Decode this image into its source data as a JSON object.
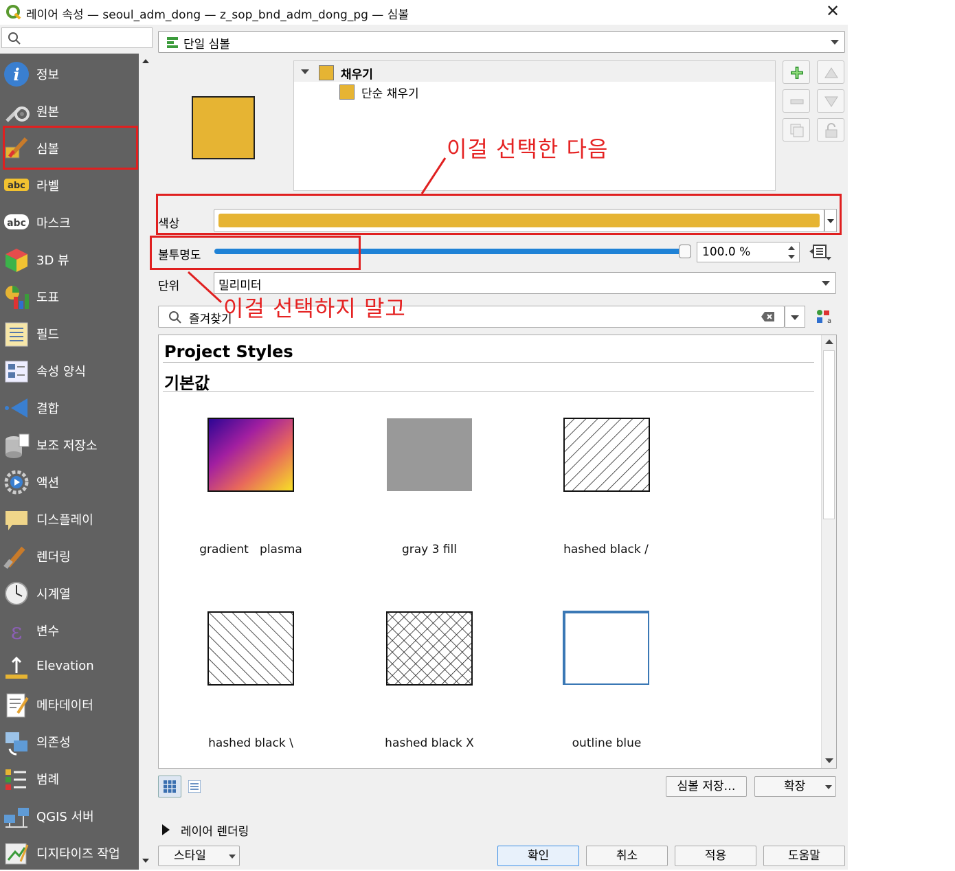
{
  "window": {
    "title": "레이어 속성 — seoul_adm_dong — z_sop_bnd_adm_dong_pg — 심볼",
    "close": "✕"
  },
  "sidebar": {
    "search_placeholder": "",
    "items": [
      {
        "label": "정보",
        "icon": "info-icon"
      },
      {
        "label": "원본",
        "icon": "source-icon"
      },
      {
        "label": "심볼",
        "icon": "symbology-icon",
        "selected": true
      },
      {
        "label": "라벨",
        "icon": "labels-icon"
      },
      {
        "label": "마스크",
        "icon": "mask-icon"
      },
      {
        "label": "3D 뷰",
        "icon": "3d-view-icon"
      },
      {
        "label": "도표",
        "icon": "diagram-icon"
      },
      {
        "label": "필드",
        "icon": "fields-icon"
      },
      {
        "label": "속성 양식",
        "icon": "attributes-form-icon"
      },
      {
        "label": "결합",
        "icon": "joins-icon"
      },
      {
        "label": "보조 저장소",
        "icon": "auxiliary-storage-icon"
      },
      {
        "label": "액션",
        "icon": "actions-icon"
      },
      {
        "label": "디스플레이",
        "icon": "display-icon"
      },
      {
        "label": "렌더링",
        "icon": "rendering-icon"
      },
      {
        "label": "시계열",
        "icon": "temporal-icon"
      },
      {
        "label": "변수",
        "icon": "variables-icon"
      },
      {
        "label": "Elevation",
        "icon": "elevation-icon"
      },
      {
        "label": "메타데이터",
        "icon": "metadata-icon"
      },
      {
        "label": "의존성",
        "icon": "dependencies-icon"
      },
      {
        "label": "범례",
        "icon": "legend-icon"
      },
      {
        "label": "QGIS 서버",
        "icon": "qgis-server-icon"
      },
      {
        "label": "디지타이즈 작업",
        "icon": "digitizing-icon"
      }
    ]
  },
  "renderer": {
    "type_label": "단일 심볼"
  },
  "symbol_tree": {
    "root_label": "채우기",
    "child_label": "단순 채우기",
    "fill_color": "#e6b433"
  },
  "properties": {
    "color_label": "색상",
    "opacity_label": "불투명도",
    "opacity_value": "100.0 %",
    "opacity_level": 1.0,
    "unit_label": "단위",
    "unit_value": "밀리미터"
  },
  "library": {
    "search_placeholder": "즐겨찾기",
    "group_project": "Project Styles",
    "group_default": "기본값",
    "symbols": [
      {
        "name": "gradient   plasma",
        "kind": "gradient"
      },
      {
        "name": "gray 3 fill",
        "kind": "gray"
      },
      {
        "name": "hashed black /",
        "kind": "hash-fwd"
      },
      {
        "name": "hashed black \\",
        "kind": "hash-back"
      },
      {
        "name": "hashed black X",
        "kind": "hash-x"
      },
      {
        "name": "outline blue",
        "kind": "outline"
      }
    ],
    "save_symbol": "심볼 저장…",
    "advanced": "확장"
  },
  "layer_rendering": {
    "label": "레이어 렌더링"
  },
  "footer": {
    "style": "스타일",
    "ok": "확인",
    "cancel": "취소",
    "apply": "적용",
    "help": "도움말"
  },
  "annotations": {
    "select_this": "이걸 선택한 다음",
    "not_this": "이걸 선택하지 말고"
  },
  "colors": {
    "sidebar_bg": "#616161",
    "annotation": "#e02020",
    "fill_swatch": "#e6b433",
    "slider": "#1f82d6"
  }
}
